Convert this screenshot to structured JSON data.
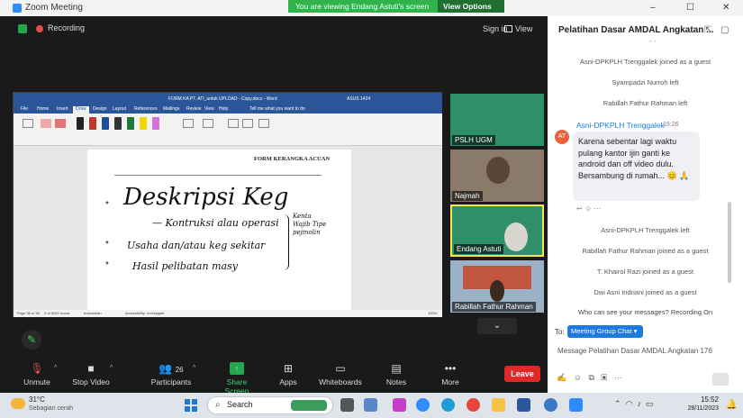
{
  "window": {
    "title": "Zoom Meeting",
    "banner_text": "You are viewing Endang Astuti's screen",
    "view_options_label": "View Options",
    "minimize": "–",
    "maximize": "☐",
    "close": "✕"
  },
  "meeting_header": {
    "recording_label": "Recording",
    "sign_in_label": "Sign in",
    "view_label": "View"
  },
  "shared_doc": {
    "doc_title": "FORM KA PT. ATI_untuk UPLOAD - Copy.docx - Word",
    "user_name": "ASUS 1424",
    "tell_me": "Tell me what you want to do",
    "menu_tabs": [
      "File",
      "Home",
      "Insert",
      "Draw",
      "Design",
      "Layout",
      "References",
      "Mailings",
      "Review",
      "View",
      "Help"
    ],
    "active_tab": "Draw",
    "page_heading": "FORM KERANGKA ACUAN",
    "handwriting": {
      "line1": "Deskripsi Keg",
      "line2": "— Kontruksi alau operasi",
      "line3": "Usaha dan/atau keg sekitar",
      "line4": "Hasil pelibatan masy",
      "side_note": "Kenta Wajib Tipe pejmolin"
    },
    "status_page": "Page 56 of 56",
    "status_words": "0 of 5062 words",
    "status_lang": "Indonesian",
    "status_access": "Accessibility: Investigate",
    "zoom_pct": "100%"
  },
  "participants_gallery": [
    {
      "name": "PSLH UGM"
    },
    {
      "name": "Najmah"
    },
    {
      "name": "Endang Astuti"
    },
    {
      "name": "Rabillah Fathur Rahman"
    }
  ],
  "gallery_more": "⌄",
  "toolbar": {
    "unmute": "Unmute",
    "stop_video": "Stop Video",
    "participants": "Participants",
    "participants_count": "26",
    "share_screen": "Share Screen",
    "apps": "Apps",
    "whiteboards": "Whiteboards",
    "notes": "Notes",
    "more": "More",
    "leave": "Leave"
  },
  "chat": {
    "title": "Pelatihan Dasar AMDAL Angkatan ...",
    "system_top": [
      "Asni-DPKPLH Trenggalek joined as a guest",
      "Syampadzi Nurroh left",
      "Rabillah Fathur Rahman left"
    ],
    "message": {
      "avatar_initials": "AT",
      "sender": "Asni-DPKPLH Trenggalek",
      "time": "15:26",
      "text": "Karena sebentar lagi waktu pulang kantor ijin ganti ke android dan off video dulu. Bersambung di rumah... 😊 🙏"
    },
    "system_bottom": [
      "Asni-DPKPLH Trenggalek left",
      "Rabillah Fathur Rahman joined as a guest",
      "T. Khairol Razi joined as a guest",
      "Dwi Asni Indriani joined as a guest"
    ],
    "privacy_note": "Who can see your messages? Recording On",
    "to_label": "To:",
    "to_value": "Meeting Group Chat",
    "input_placeholder": "Message Pelatihan Dasar AMDAL Angkatan 176"
  },
  "taskbar": {
    "temperature": "31°C",
    "weather": "Sebagian cerah",
    "search_label": "Search",
    "time": "15:52",
    "date": "28/11/2023"
  },
  "colors": {
    "zoom_blue": "#2d8cff",
    "banner_green": "#2fb34a",
    "leave_red": "#e02828",
    "word_blue": "#2b579a",
    "active_speaker_border": "#f7e54a"
  }
}
